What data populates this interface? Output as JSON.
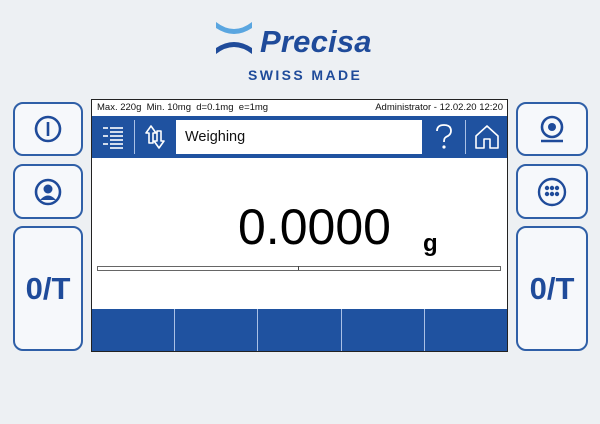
{
  "brand": {
    "name": "Precisa",
    "tagline": "SWISS MADE",
    "color": "#1f4b9a"
  },
  "left_panel": {
    "buttons": [
      {
        "icon": "power-icon"
      },
      {
        "icon": "user-icon"
      },
      {
        "label": "0/T"
      }
    ]
  },
  "right_panel": {
    "buttons": [
      {
        "icon": "level-icon"
      },
      {
        "icon": "keypad-icon"
      },
      {
        "label": "0/T"
      }
    ]
  },
  "status": {
    "capacity": "Max. 220g  Min. 10mg  d=0.1mg  e=1mg",
    "user_datetime": "Administrator - 12.02.20 12:20"
  },
  "toolbar": {
    "menu_icon": "list-menu-icon",
    "sort_icon": "up-down-arrows-icon",
    "title": "Weighing",
    "help_icon": "help-icon",
    "home_icon": "home-icon",
    "color": "#1f52a0"
  },
  "display": {
    "weight": "0.0000",
    "unit": "g"
  },
  "softkeys": [
    "",
    "",
    "",
    "",
    ""
  ]
}
